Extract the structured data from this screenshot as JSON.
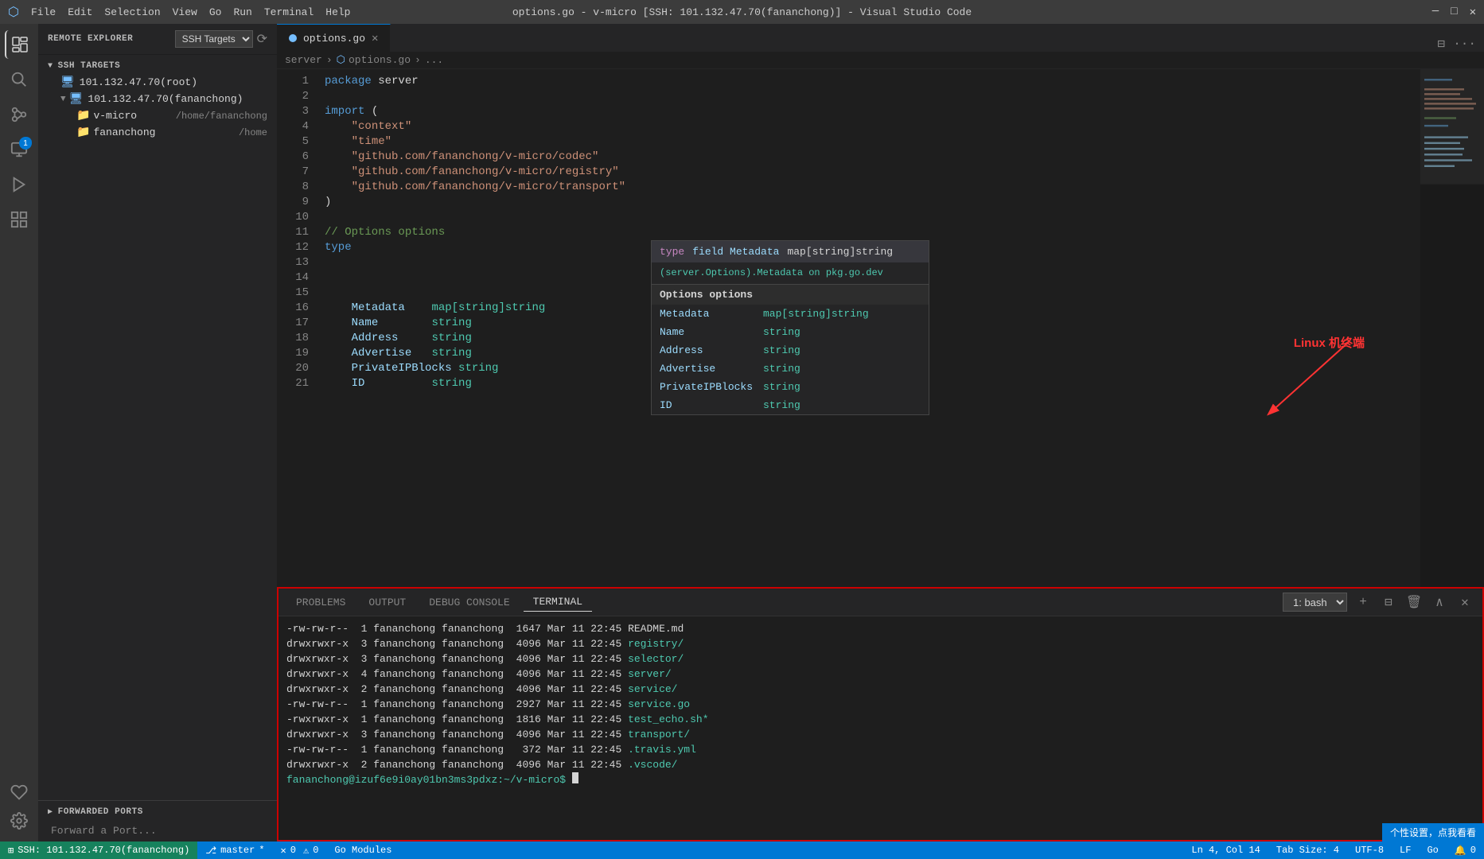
{
  "titleBar": {
    "logo": "⬡",
    "menus": [
      "File",
      "Edit",
      "Selection",
      "View",
      "Go",
      "Run",
      "Terminal",
      "Help"
    ],
    "title": "options.go - v-micro [SSH: 101.132.47.70(fananchong)] - Visual Studio Code",
    "controls": [
      "─",
      "□",
      "✕"
    ]
  },
  "activityBar": {
    "icons": [
      {
        "name": "explorer-icon",
        "symbol": "⬡",
        "active": true
      },
      {
        "name": "search-icon",
        "symbol": "🔍"
      },
      {
        "name": "scm-icon",
        "symbol": "⎇"
      },
      {
        "name": "remote-icon",
        "symbol": "⊞",
        "badge": "1"
      },
      {
        "name": "debug-icon",
        "symbol": "▶"
      },
      {
        "name": "extensions-icon",
        "symbol": "⊞"
      }
    ],
    "bottomIcons": [
      {
        "name": "remote-ssh-icon",
        "symbol": "⊞"
      },
      {
        "name": "settings-icon",
        "symbol": "⚙"
      }
    ]
  },
  "sidebar": {
    "title": "REMOTE EXPLORER",
    "dropdown": "SSH Targets",
    "sections": {
      "sshTargets": {
        "header": "SSH TARGETS",
        "items": [
          {
            "label": "101.132.47.70(root)",
            "indent": 1,
            "icon": "monitor"
          },
          {
            "label": "101.132.47.70(fananchong)",
            "indent": 1,
            "icon": "monitor",
            "expanded": true,
            "children": [
              {
                "label": "v-micro",
                "path": "/home/fananchong",
                "indent": 2,
                "icon": "folder"
              },
              {
                "label": "fananchong",
                "path": "/home",
                "indent": 2,
                "icon": "folder"
              }
            ]
          }
        ]
      },
      "forwardedPorts": {
        "header": "FORWARDED PORTS",
        "forwardLabel": "Forward a Port..."
      }
    }
  },
  "editor": {
    "tabLabel": "options.go",
    "tabModified": true,
    "breadcrumb": [
      "server",
      "options.go",
      "..."
    ],
    "lines": [
      {
        "num": 1,
        "code": "package server",
        "type": "package"
      },
      {
        "num": 2,
        "code": "",
        "type": "empty"
      },
      {
        "num": 3,
        "code": "import (",
        "type": "import"
      },
      {
        "num": 4,
        "code": "    \"context\"",
        "type": "import-str"
      },
      {
        "num": 5,
        "code": "    \"time\"",
        "type": "import-str"
      },
      {
        "num": 6,
        "code": "    \"github.com/fananchong/v-micro/codec\"",
        "type": "import-str"
      },
      {
        "num": 7,
        "code": "    \"github.com/fananchong/v-micro/registry\"",
        "type": "import-str"
      },
      {
        "num": 8,
        "code": "    \"github.com/fananchong/v-micro/transport\"",
        "type": "import-str"
      },
      {
        "num": 9,
        "code": ")",
        "type": "close"
      },
      {
        "num": 10,
        "code": "",
        "type": "empty"
      },
      {
        "num": 11,
        "code": "// Options options",
        "type": "comment"
      },
      {
        "num": 12,
        "code": "type ",
        "type": "keyword"
      },
      {
        "num": 13,
        "code": "",
        "type": "empty"
      },
      {
        "num": 14,
        "code": "",
        "type": "empty"
      },
      {
        "num": 15,
        "code": "",
        "type": "empty"
      },
      {
        "num": 16,
        "code": "    Metadata    map[string]string",
        "type": "field"
      },
      {
        "num": 17,
        "code": "    Name        string",
        "type": "field"
      },
      {
        "num": 18,
        "code": "    Address     string",
        "type": "field"
      },
      {
        "num": 19,
        "code": "    Advertise   string",
        "type": "field"
      },
      {
        "num": 20,
        "code": "    PrivateIPBlocks string",
        "type": "field"
      },
      {
        "num": 21,
        "code": "    ID          string",
        "type": "field"
      }
    ],
    "autocomplete": {
      "header": {
        "type": "type",
        "name": "field Metadata",
        "sig": "map[string]string"
      },
      "doc": "(server.Options).Metadata  on pkg.go.dev",
      "title": "Options options",
      "fields": [
        {
          "field": "Metadata",
          "type": "map[string]string"
        },
        {
          "field": "Name",
          "type": "string"
        },
        {
          "field": "Address",
          "type": "string"
        },
        {
          "field": "Advertise",
          "type": "string"
        },
        {
          "field": "PrivateIPBlocks",
          "type": "string"
        },
        {
          "field": "ID",
          "type": "string"
        }
      ]
    },
    "annotation": {
      "text": "Linux 机终端",
      "arrowNote": "points to terminal"
    }
  },
  "terminal": {
    "tabs": [
      "PROBLEMS",
      "OUTPUT",
      "DEBUG CONSOLE",
      "TERMINAL"
    ],
    "activeTab": "TERMINAL",
    "bashLabel": "1: bash",
    "lines": [
      "-rw-rw-r--  1 fananchong fananchong  1647 Mar 11 22:45 README.md",
      "drwxrwxr-x  3 fananchong fananchong  4096 Mar 11 22:45 registry/",
      "drwxrwxr-x  3 fananchong fananchong  4096 Mar 11 22:45 selector/",
      "drwxrwxr-x  4 fananchong fananchong  4096 Mar 11 22:45 server/",
      "drwxrwxr-x  2 fananchong fananchong  4096 Mar 11 22:45 service/",
      "-rw-rw-r--  1 fananchong fananchong  2927 Mar 11 22:45 service.go",
      "-rwxrwxr-x  1 fananchong fananchong  1816 Mar 11 22:45 test_echo.sh*",
      "drwxrwxr-x  3 fananchong fananchong  4096 Mar 11 22:45 transport/",
      "-rw-rw-r--  1 fananchong fananchong   372 Mar 11 22:45 .travis.yml",
      "drwxrwxr-x  2 fananchong fananchong  4096 Mar 11 22:45 .vscode/"
    ],
    "coloredItems": [
      "registry/",
      "selector/",
      "server/",
      "service/",
      "service.go",
      "test_echo.sh*",
      "transport/",
      ".travis.yml",
      ".vscode/"
    ],
    "prompt": "fananchong@izuf6e9i0ay01bn3ms3pdxz:~/v-micro$"
  },
  "statusBar": {
    "remote": "SSH: 101.132.47.70(fananchong)",
    "branch": "master",
    "branchModified": true,
    "errors": "0",
    "warnings": "0",
    "goModules": "Go Modules",
    "cursor": "Ln 4, Col 14",
    "tabSize": "Tab Size: 4",
    "encoding": "UTF-8",
    "lineEnding": "LF",
    "language": "Go",
    "notifications": "0",
    "tooltipBadge": "个性设置，点我看看"
  }
}
